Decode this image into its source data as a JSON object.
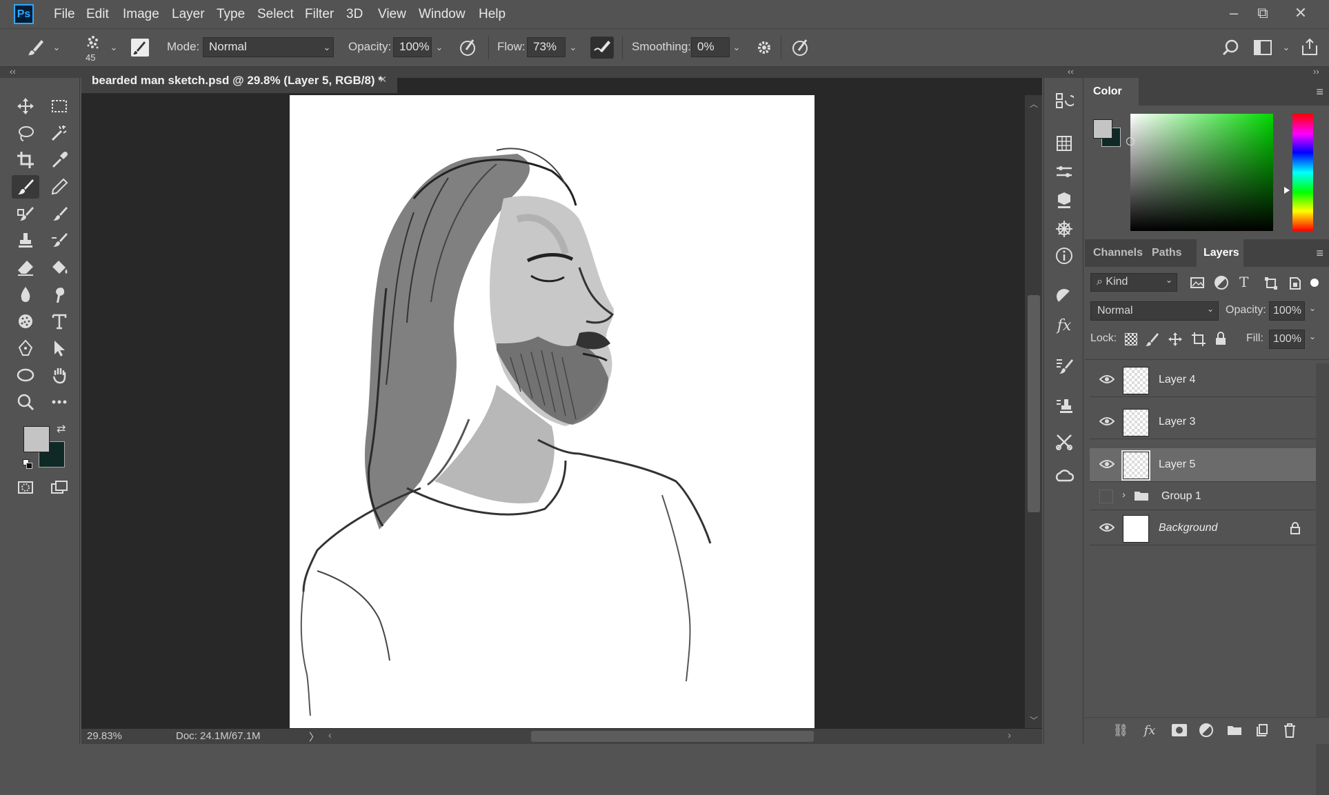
{
  "app": {
    "logo": "Ps"
  },
  "menu": [
    "File",
    "Edit",
    "Image",
    "Layer",
    "Type",
    "Select",
    "Filter",
    "3D",
    "View",
    "Window",
    "Help"
  ],
  "window_controls": {
    "minimize": "–",
    "restore": "⧉",
    "close": "✕"
  },
  "options": {
    "brush_size": "45",
    "mode_label": "Mode:",
    "mode_value": "Normal",
    "opacity_label": "Opacity:",
    "opacity_value": "100%",
    "flow_label": "Flow:",
    "flow_value": "73%",
    "smoothing_label": "Smoothing:",
    "smoothing_value": "0%"
  },
  "document": {
    "tab_label": "bearded man sketch.psd @ 29.8% (Layer 5, RGB/8) *",
    "close": "×"
  },
  "status": {
    "zoom": "29.83%",
    "doc": "Doc: 24.1M/67.1M",
    "arrow": "〉"
  },
  "colors": {
    "foreground": "#c4c4c4",
    "background": "#0f2a26",
    "accent": "#31a8ff"
  },
  "color_panel": {
    "title": "Color"
  },
  "layers_panel": {
    "tabs": [
      "Channels",
      "Paths",
      "Layers"
    ],
    "active_tab": "Layers",
    "filter_label": "Kind",
    "blend_mode": "Normal",
    "opacity_label": "Opacity:",
    "opacity_value": "100%",
    "lock_label": "Lock:",
    "fill_label": "Fill:",
    "fill_value": "100%",
    "layers": [
      {
        "name": "Layer 4",
        "visible": true,
        "selected": false,
        "type": "layer"
      },
      {
        "name": "Layer 3",
        "visible": true,
        "selected": false,
        "type": "layer"
      },
      {
        "name": "Layer 5",
        "visible": true,
        "selected": true,
        "type": "layer"
      },
      {
        "name": "Group 1",
        "visible": false,
        "selected": false,
        "type": "group"
      },
      {
        "name": "Background",
        "visible": true,
        "selected": false,
        "type": "background",
        "locked": true
      }
    ]
  }
}
